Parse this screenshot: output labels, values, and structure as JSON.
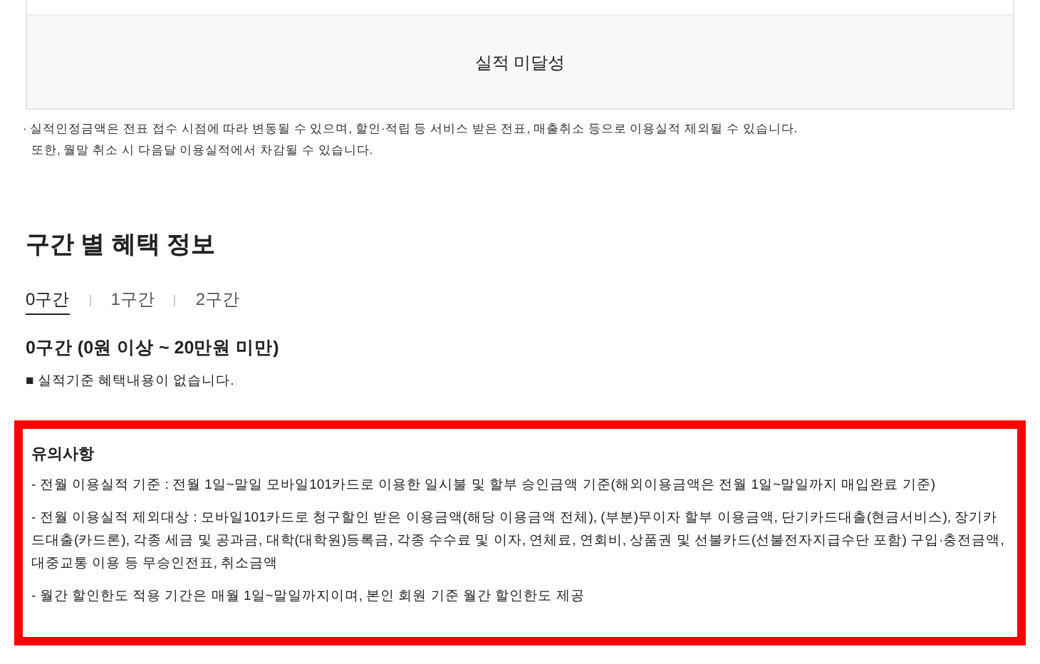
{
  "status_panel": {
    "label": "실적 미달성"
  },
  "notes": [
    "· 실적인정금액은 전표 접수 시점에 따라 변동될 수 있으며, 할인·적립 등 서비스 받은 전표, 매출취소 등으로 이용실적 제외될 수 있습니다.",
    "또한, 월말 취소 시 다음달 이용실적에서 차감될 수 있습니다."
  ],
  "section": {
    "title": "구간 별 혜택 정보",
    "tabs": [
      {
        "label": "0구간",
        "selected": true
      },
      {
        "label": "1구간",
        "selected": false
      },
      {
        "label": "2구간",
        "selected": false
      }
    ],
    "tier_title": "0구간 (0원 이상 ~ 20만원 미만)",
    "tier_benefit": "■ 실적기준 혜택내용이 없습니다."
  },
  "caution": {
    "title": "유의사항",
    "highlighted": true,
    "items": [
      "- 전월 이용실적 기준 : 전월 1일~말일 모바일101카드로 이용한 일시불 및 할부 승인금액 기준(해외이용금액은 전월 1일~말일까지 매입완료 기준)",
      "- 전월 이용실적 제외대상 : 모바일101카드로 청구할인 받은 이용금액(해당 이용금액 전체), (부분)무이자 할부 이용금액, 단기카드대출(현금서비스), 장기카드대출(카드론), 각종 세금 및 공과금, 대학(대학원)등록금, 각종 수수료 및 이자, 연체료, 연회비, 상품권 및 선불카드(선불전자지급수단 포함) 구입·충전금액, 대중교통 이용 등 무승인전표, 취소금액",
      "- 월간 할인한도 적용 기간은 매월 1일~말일까지이며, 본인 회원 기준 월간 할인한도 제공"
    ]
  }
}
